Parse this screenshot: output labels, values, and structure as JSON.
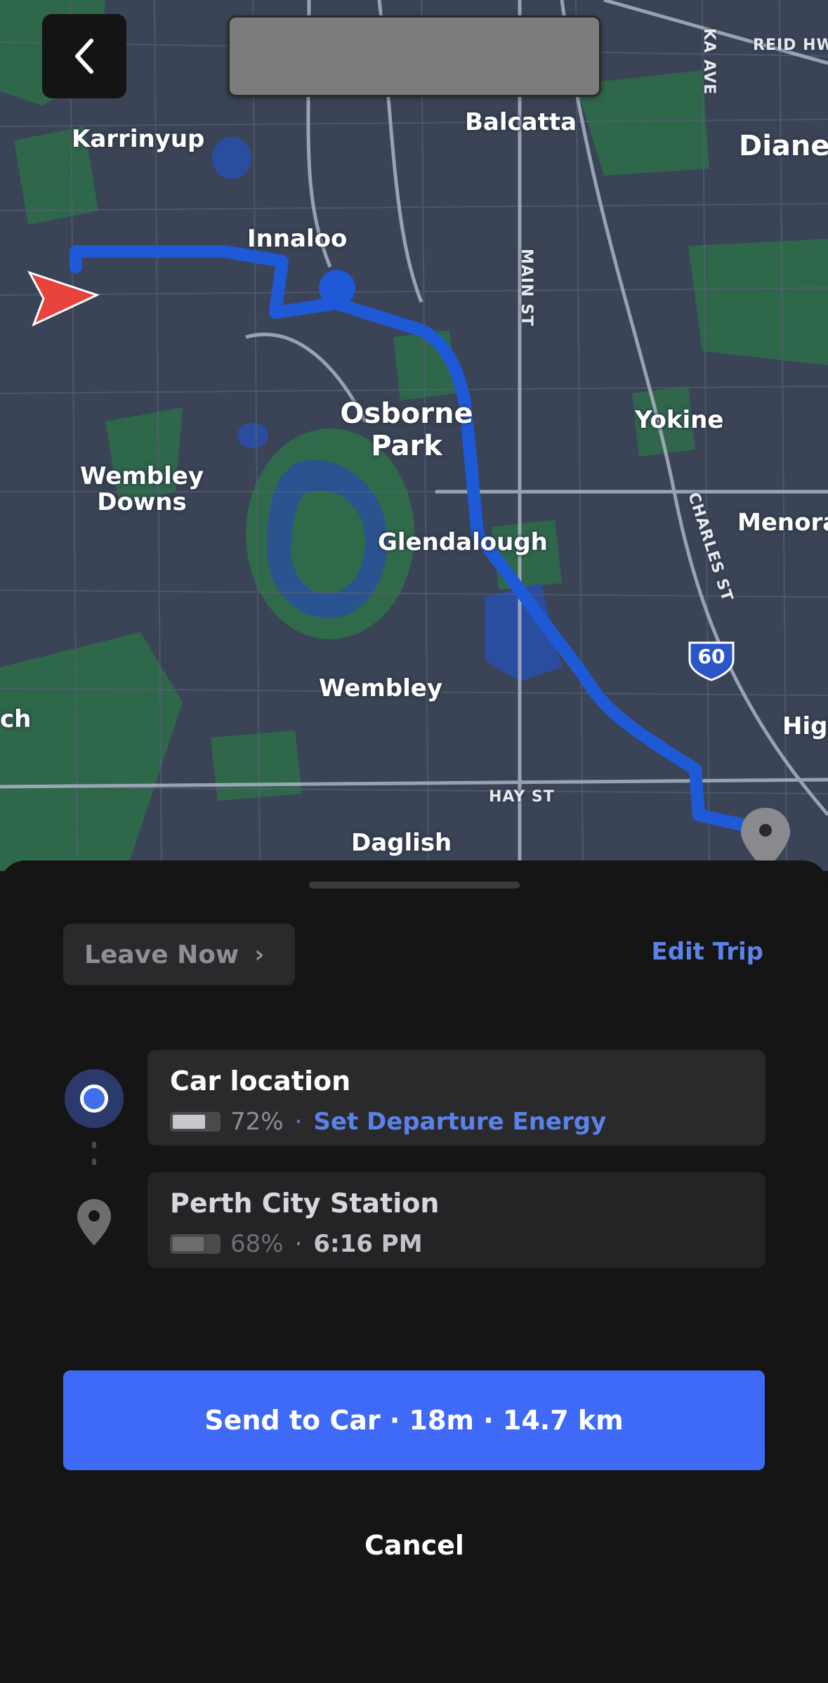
{
  "header": {
    "back_icon": "chevron-left-icon",
    "title_redacted": true
  },
  "map": {
    "suburbs": [
      "Karrinyup",
      "Balcatta",
      "Dianel",
      "Innaloo",
      "Osborne Park",
      "Yokine",
      "Wembley Downs",
      "Glendalough",
      "Menora",
      "Wembley",
      "ch",
      "High",
      "Daglish"
    ],
    "streets": [
      "REID HW",
      "KA AVE",
      "MAIN ST",
      "CHARLES ST",
      "HAY ST"
    ],
    "highway_shield": "60",
    "colors": {
      "route": "#1e5ad8",
      "origin_arrow": "#e8423c",
      "park": "#2f6b4a",
      "water": "#2a4da0"
    }
  },
  "sheet": {
    "leave_now": "Leave Now",
    "edit_trip": "Edit Trip",
    "origin": {
      "name": "Car location",
      "battery_pct": 72,
      "battery_text": "72%",
      "separator": "·",
      "link": "Set Departure Energy"
    },
    "destination": {
      "name": "Perth City Station",
      "battery_pct": 68,
      "battery_text": "68%",
      "separator": "·",
      "eta": "6:16 PM"
    },
    "send_button": "Send to Car · 18m · 14.7 km",
    "cancel": "Cancel"
  }
}
